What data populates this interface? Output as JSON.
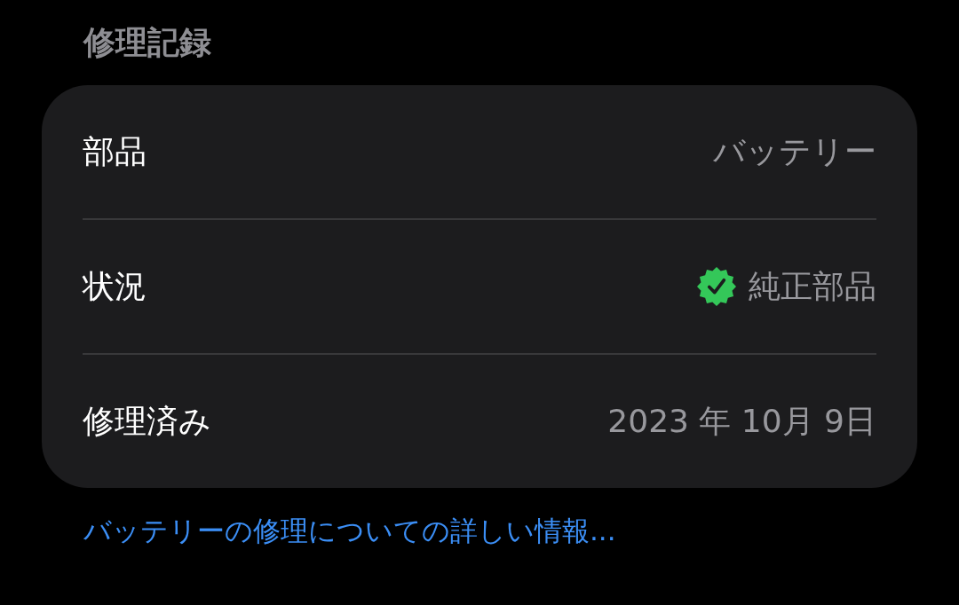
{
  "section": {
    "title": "修理記録"
  },
  "rows": [
    {
      "label": "部品",
      "value": "バッテリー",
      "kind": "text"
    },
    {
      "label": "状況",
      "value": "純正部品",
      "kind": "badge",
      "color": "#34c759"
    },
    {
      "label": "修理済み",
      "value": "2023 年 10月 9日",
      "kind": "text"
    }
  ],
  "footer_link": "バッテリーの修理についての詳しい情報..."
}
